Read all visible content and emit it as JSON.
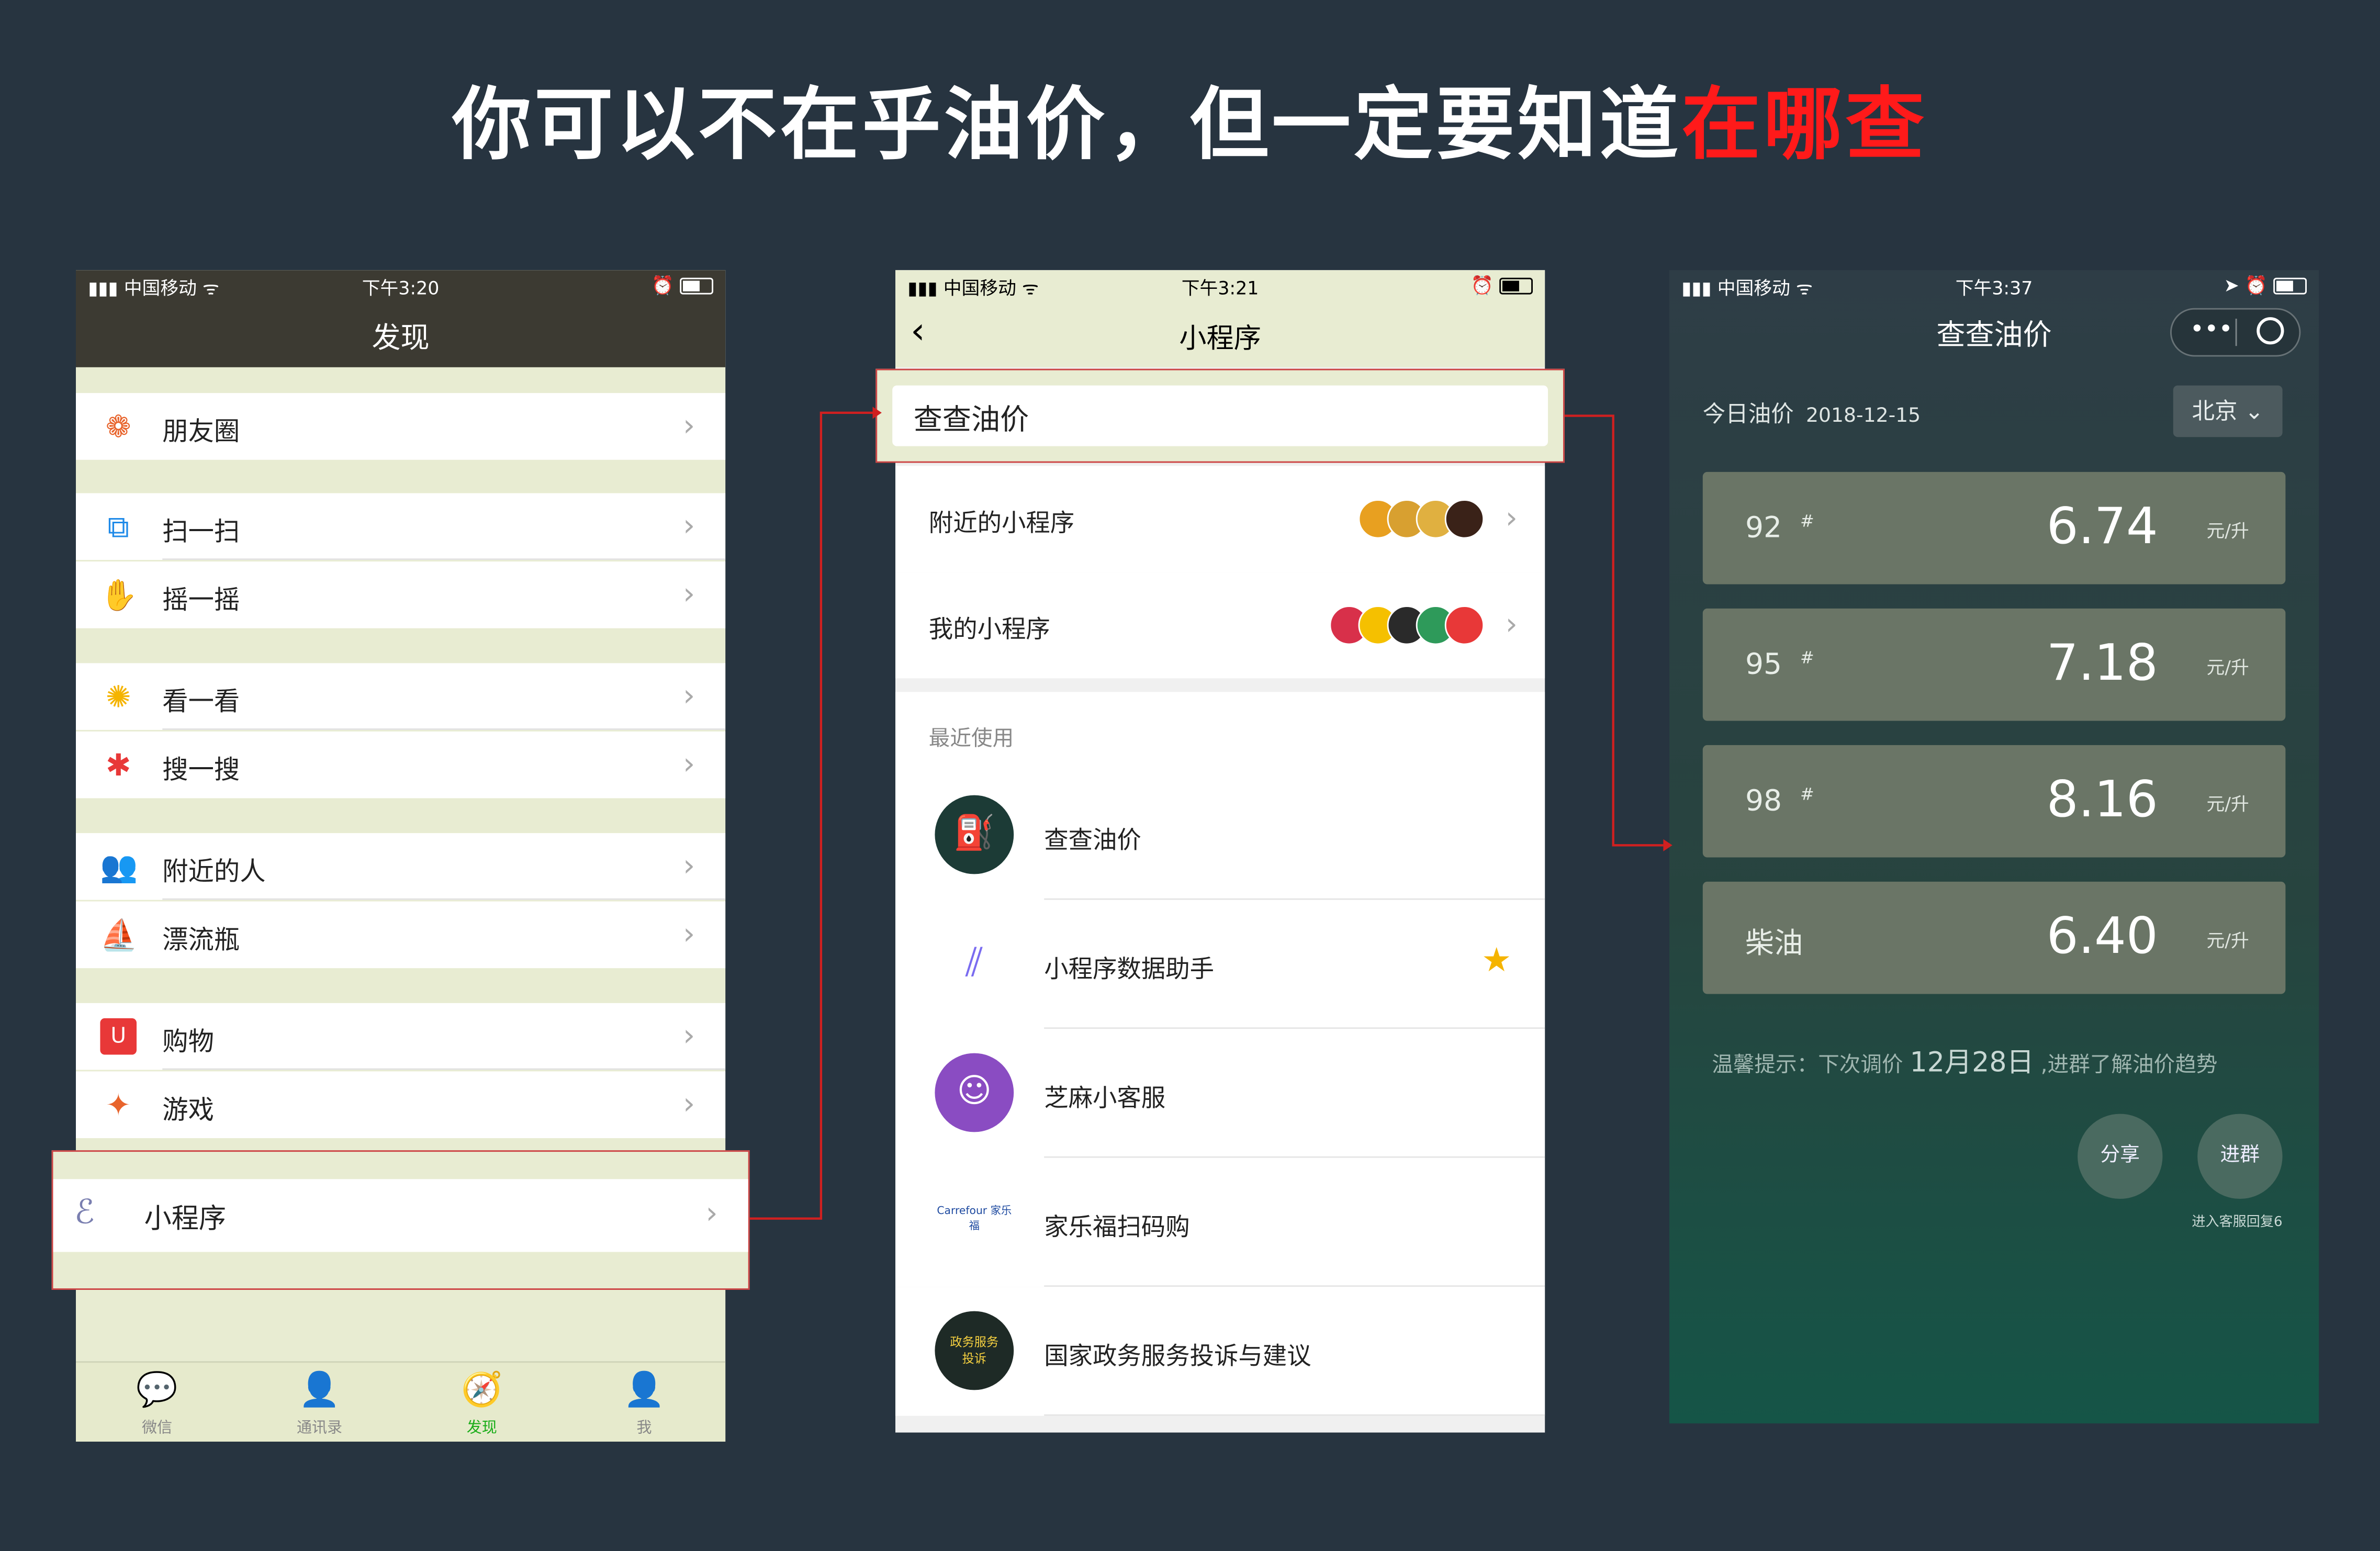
{
  "headline": {
    "text": "你可以不在乎油价，但一定要知道",
    "highlight": "在哪查",
    "highlight_color": "#ff1a1a"
  },
  "phone1": {
    "status": {
      "carrier": "中国移动",
      "time": "下午3:20"
    },
    "title": "发现",
    "items": [
      {
        "label": "朋友圈",
        "icon": "moments-icon"
      },
      {
        "label": "扫一扫",
        "icon": "scan-icon"
      },
      {
        "label": "摇一摇",
        "icon": "shake-icon"
      },
      {
        "label": "看一看",
        "icon": "top-stories-icon"
      },
      {
        "label": "搜一搜",
        "icon": "search-icon"
      },
      {
        "label": "附近的人",
        "icon": "people-nearby-icon"
      },
      {
        "label": "漂流瓶",
        "icon": "drift-bottle-icon"
      },
      {
        "label": "购物",
        "icon": "shopping-icon"
      },
      {
        "label": "游戏",
        "icon": "games-icon"
      },
      {
        "label": "小程序",
        "icon": "mini-program-icon"
      }
    ],
    "tabs": [
      {
        "label": "微信",
        "icon": "chat-icon"
      },
      {
        "label": "通讯录",
        "icon": "contacts-icon"
      },
      {
        "label": "发现",
        "icon": "discover-icon",
        "active": true
      },
      {
        "label": "我",
        "icon": "me-icon"
      }
    ]
  },
  "phone2": {
    "status": {
      "carrier": "中国移动",
      "time": "下午3:21"
    },
    "title": "小程序",
    "search_value": "查查油价",
    "rows": [
      {
        "label": "附近的小程序"
      },
      {
        "label": "我的小程序"
      }
    ],
    "recent_header": "最近使用",
    "recent": [
      {
        "label": "查查油价",
        "logo_color": "#1c3b36"
      },
      {
        "label": "小程序数据助手",
        "logo_color": "#ffffff",
        "starred": true
      },
      {
        "label": "芝麻小客服",
        "logo_color": "#8a4cc2"
      },
      {
        "label": "家乐福扫码购",
        "logo_color": "#ffffff",
        "logo_text": "Carrefour 家乐福"
      },
      {
        "label": "国家政务服务投诉与建议",
        "logo_color": "#1e2a26",
        "logo_text": "政务服务 投诉"
      }
    ]
  },
  "phone3": {
    "status": {
      "carrier": "中国移动",
      "time": "下午3:37"
    },
    "title": "查查油价",
    "today_label": "今日油价",
    "date": "2018-12-15",
    "city": "北京",
    "prices": [
      {
        "grade": "92",
        "mark": "#",
        "value": "6.74",
        "unit": "元/升"
      },
      {
        "grade": "95",
        "mark": "#",
        "value": "7.18",
        "unit": "元/升"
      },
      {
        "grade": "98",
        "mark": "#",
        "value": "8.16",
        "unit": "元/升"
      },
      {
        "grade": "柴油",
        "mark": "",
        "value": "6.40",
        "unit": "元/升"
      }
    ],
    "tip_prefix": "温馨提示：下次调价",
    "tip_date": "12月28日",
    "tip_suffix": ",进群了解油价趋势",
    "share_label": "分享",
    "join_label": "进群",
    "join_note": "进入客服回复6"
  }
}
